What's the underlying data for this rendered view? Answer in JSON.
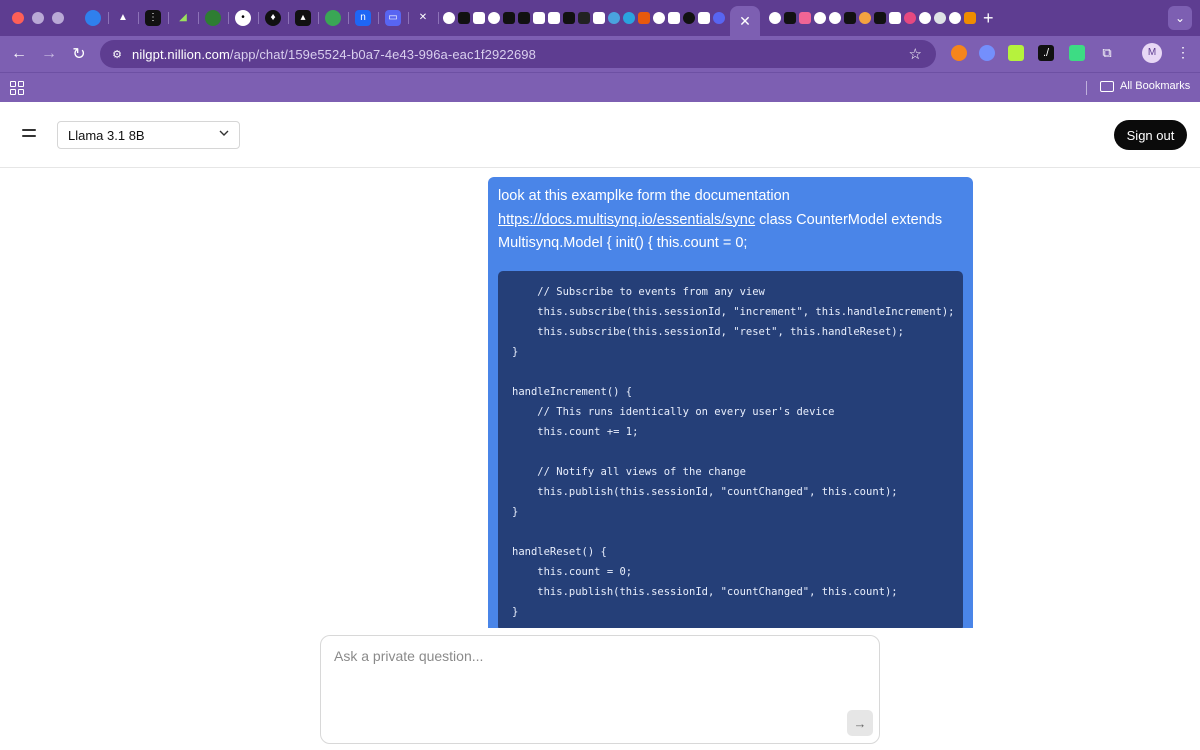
{
  "browser": {
    "url_host": "nilgpt.nillion.com",
    "url_path": "/app/chat/159e5524-b0a7-4e43-996a-eac1f2922698",
    "bookmarks_label": "All Bookmarks",
    "profile_initial": "M",
    "new_tab_symbol": "+",
    "close_tab_symbol": "✕"
  },
  "header": {
    "model_selected": "Llama 3.1 8B",
    "signout_label": "Sign out"
  },
  "message": {
    "text_before_link": "look at this examplke form the documentation ",
    "link_text": "https://docs.multisynq.io/essentials/sync",
    "text_after_link": " class CounterModel extends Multisynq.Model { init() { this.count = 0;",
    "code_lines": [
      "    // Subscribe to events from any view",
      "    this.subscribe(this.sessionId, \"increment\", this.handleIncrement);",
      "    this.subscribe(this.sessionId, \"reset\", this.handleReset);",
      "}",
      "",
      "handleIncrement() {",
      "    // This runs identically on every user's device",
      "    this.count += 1;",
      "",
      "    // Notify all views of the change",
      "    this.publish(this.sessionId, \"countChanged\", this.count);",
      "}",
      "",
      "handleReset() {",
      "    this.count = 0;",
      "    this.publish(this.sessionId, \"countChanged\", this.count);",
      "}"
    ]
  },
  "composer": {
    "placeholder": "Ask a private question...",
    "value": ""
  },
  "colors": {
    "chrome_dark": "#5e3d91",
    "chrome_light": "#7d5fb2",
    "bubble": "#4a85e8",
    "code_bg": "#253f78"
  }
}
